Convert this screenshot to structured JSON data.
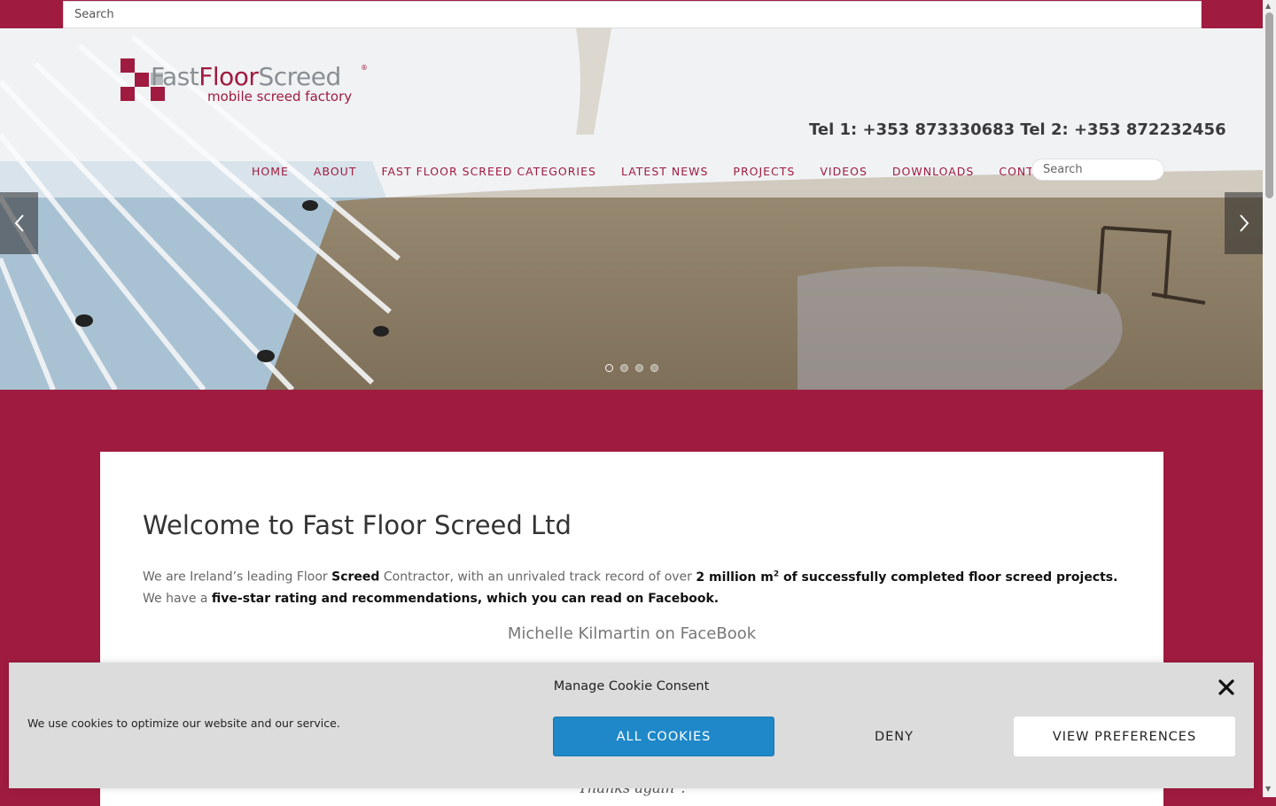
{
  "top_search": {
    "placeholder": "Search"
  },
  "logo": {
    "part1": "Fast",
    "part2": "Floor",
    "part3": "Screed",
    "tagline": "mobile screed factory",
    "reg": "®"
  },
  "header": {
    "tel": "Tel 1: +353 873330683 Tel 2: +353 872232456"
  },
  "nav": {
    "items": [
      {
        "label": "HOME"
      },
      {
        "label": "ABOUT"
      },
      {
        "label": "FAST FLOOR SCREED CATEGORIES"
      },
      {
        "label": "LATEST NEWS"
      },
      {
        "label": "PROJECTS"
      },
      {
        "label": "VIDEOS"
      },
      {
        "label": "DOWNLOADS"
      },
      {
        "label": "CONTACT US"
      }
    ],
    "search_placeholder": "Search"
  },
  "slider": {
    "slides_count": 4,
    "active_index": 0
  },
  "content": {
    "title": "Welcome to Fast Floor Screed Ltd",
    "intro": {
      "p1": "We are Ireland’s leading Floor ",
      "b1": "Screed",
      "p2": " Contractor, with an unrivaled track record of over ",
      "b2": "2 million m",
      "sup": "2",
      "b3": " of successfully completed floor screed projects.",
      "p3": " We have a ",
      "b4": "five-star rating and recommendations, which you can read on Facebook."
    },
    "fb_name": "Michelle Kilmartin on FaceBook",
    "quote_end": "Thanks again\"."
  },
  "cookie": {
    "title": "Manage Cookie Consent",
    "message": "We use cookies to optimize our website and our service.",
    "accept": "ALL COOKIES",
    "deny": "DENY",
    "prefs": "VIEW PREFERENCES"
  },
  "colors": {
    "brand": "#a01b40",
    "accept_button": "#1e88c8"
  }
}
